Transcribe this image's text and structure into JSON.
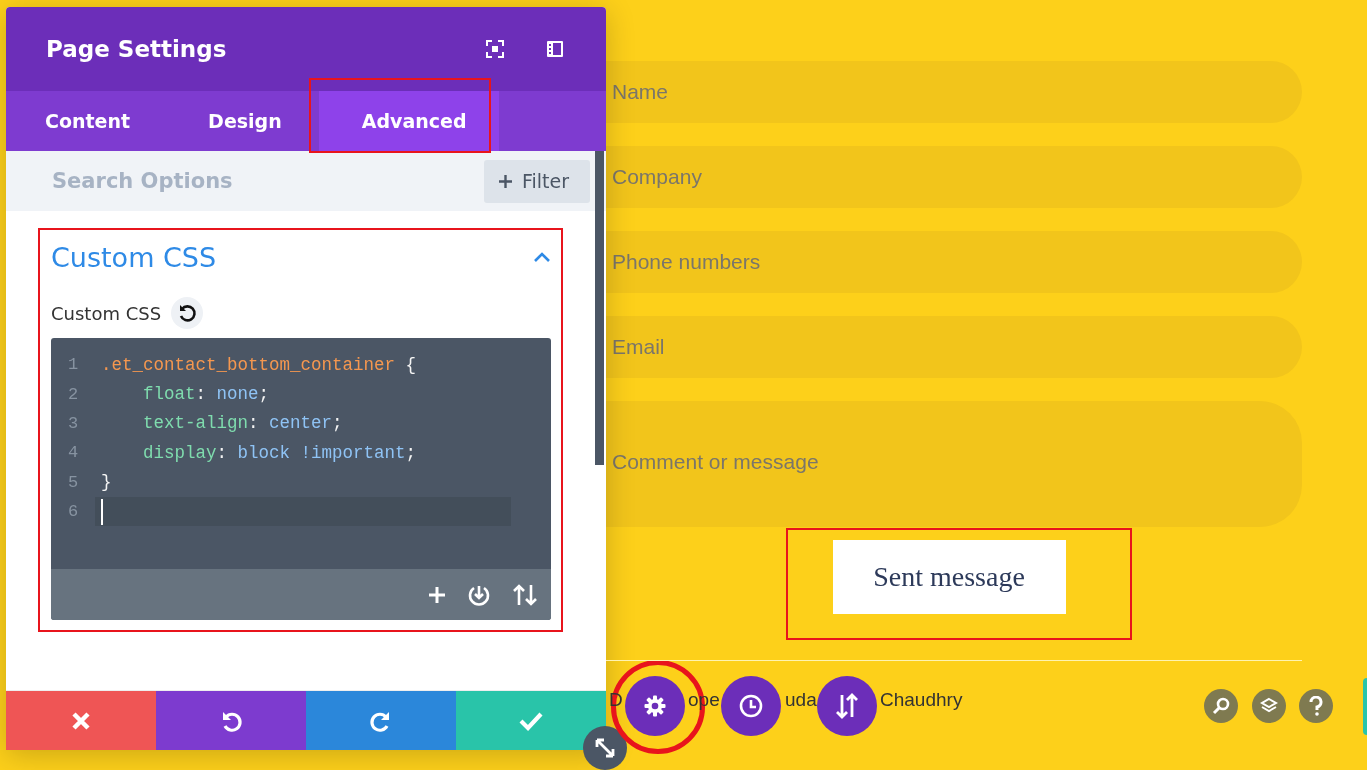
{
  "panel": {
    "title": "Page Settings",
    "tabs": [
      {
        "label": "Content",
        "selected": false
      },
      {
        "label": "Design",
        "selected": false
      },
      {
        "label": "Advanced",
        "selected": true
      }
    ],
    "search": {
      "placeholder": "Search Options"
    },
    "filter_button": "Filter",
    "section": {
      "title": "Custom CSS",
      "expanded": true,
      "field_label": "Custom CSS",
      "code": [
        {
          "number": "1",
          "kind": "rule",
          "active": false,
          "tokens": [
            {
              "kind": "selector",
              "text": ".et_contact_bottom_container"
            },
            {
              "kind": "punct",
              "text": " {"
            }
          ]
        },
        {
          "number": "2",
          "kind": "declaration",
          "active": false,
          "tokens": [
            {
              "kind": "property",
              "text": "float"
            },
            {
              "kind": "punct",
              "text": ": "
            },
            {
              "kind": "value",
              "text": "none"
            },
            {
              "kind": "punct",
              "text": ";"
            }
          ]
        },
        {
          "number": "3",
          "kind": "declaration",
          "active": false,
          "tokens": [
            {
              "kind": "property",
              "text": "text-align"
            },
            {
              "kind": "punct",
              "text": ": "
            },
            {
              "kind": "value",
              "text": "center"
            },
            {
              "kind": "punct",
              "text": ";"
            }
          ]
        },
        {
          "number": "4",
          "kind": "declaration",
          "active": false,
          "tokens": [
            {
              "kind": "property",
              "text": "display"
            },
            {
              "kind": "punct",
              "text": ": "
            },
            {
              "kind": "value",
              "text": "block !important"
            },
            {
              "kind": "punct",
              "text": ";"
            }
          ]
        },
        {
          "number": "5",
          "kind": "rule",
          "active": false,
          "tokens": [
            {
              "kind": "punct",
              "text": "}"
            }
          ]
        },
        {
          "number": "6",
          "active": true
        }
      ]
    },
    "actions": [
      {
        "kind": "discard"
      },
      {
        "kind": "undo"
      },
      {
        "kind": "redo"
      },
      {
        "kind": "save"
      }
    ]
  },
  "form": {
    "fields": [
      {
        "kind": "line",
        "placeholder": "Name"
      },
      {
        "kind": "line",
        "placeholder": "Company"
      },
      {
        "kind": "line",
        "placeholder": "Phone numbers"
      },
      {
        "kind": "line",
        "placeholder": "Email"
      },
      {
        "kind": "multiline",
        "placeholder": "Comment or message"
      }
    ],
    "submit": "Sent message"
  },
  "footer_fragments": [
    "D",
    "ope",
    "uda",
    "Chaudhry"
  ]
}
